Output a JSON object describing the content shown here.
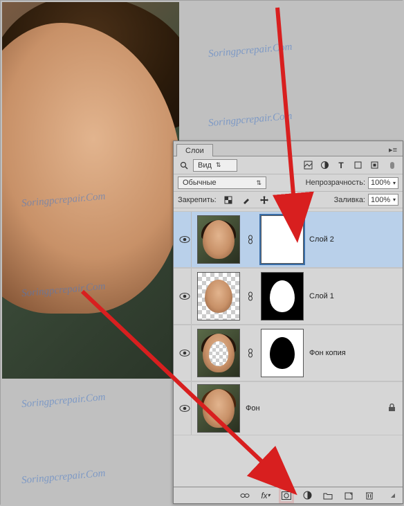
{
  "watermark_text": "Soringpcrepair.Com",
  "panel": {
    "tab_label": "Слои",
    "search_kind": "Вид",
    "blend_mode": "Обычные",
    "opacity_label": "Непрозрачность:",
    "opacity_value": "100%",
    "lock_label": "Закрепить:",
    "fill_label": "Заливка:",
    "fill_value": "100%"
  },
  "filter_icons": [
    "image-filter-icon",
    "adjust-filter-icon",
    "type-filter-icon",
    "shape-filter-icon",
    "smart-filter-icon"
  ],
  "lock_icons": [
    "lock-pixels-icon",
    "lock-brush-icon",
    "lock-move-icon",
    "lock-all-icon"
  ],
  "layers": [
    {
      "name": "Слой 2",
      "has_mask": true,
      "selected": true,
      "mask_style": "white",
      "thumb": "face1"
    },
    {
      "name": "Слой 1",
      "has_mask": true,
      "selected": false,
      "mask_style": "ovalwhite",
      "thumb": "face2"
    },
    {
      "name": "Фон копия",
      "has_mask": true,
      "selected": false,
      "mask_style": "ovalblack",
      "thumb": "cutout"
    },
    {
      "name": "Фон",
      "has_mask": false,
      "selected": false,
      "locked": true,
      "thumb": "face3"
    }
  ],
  "bottom_icons": [
    "link-icon",
    "fx-icon",
    "mask-add-icon",
    "adjustment-icon",
    "group-icon",
    "new-layer-icon",
    "trash-icon"
  ]
}
